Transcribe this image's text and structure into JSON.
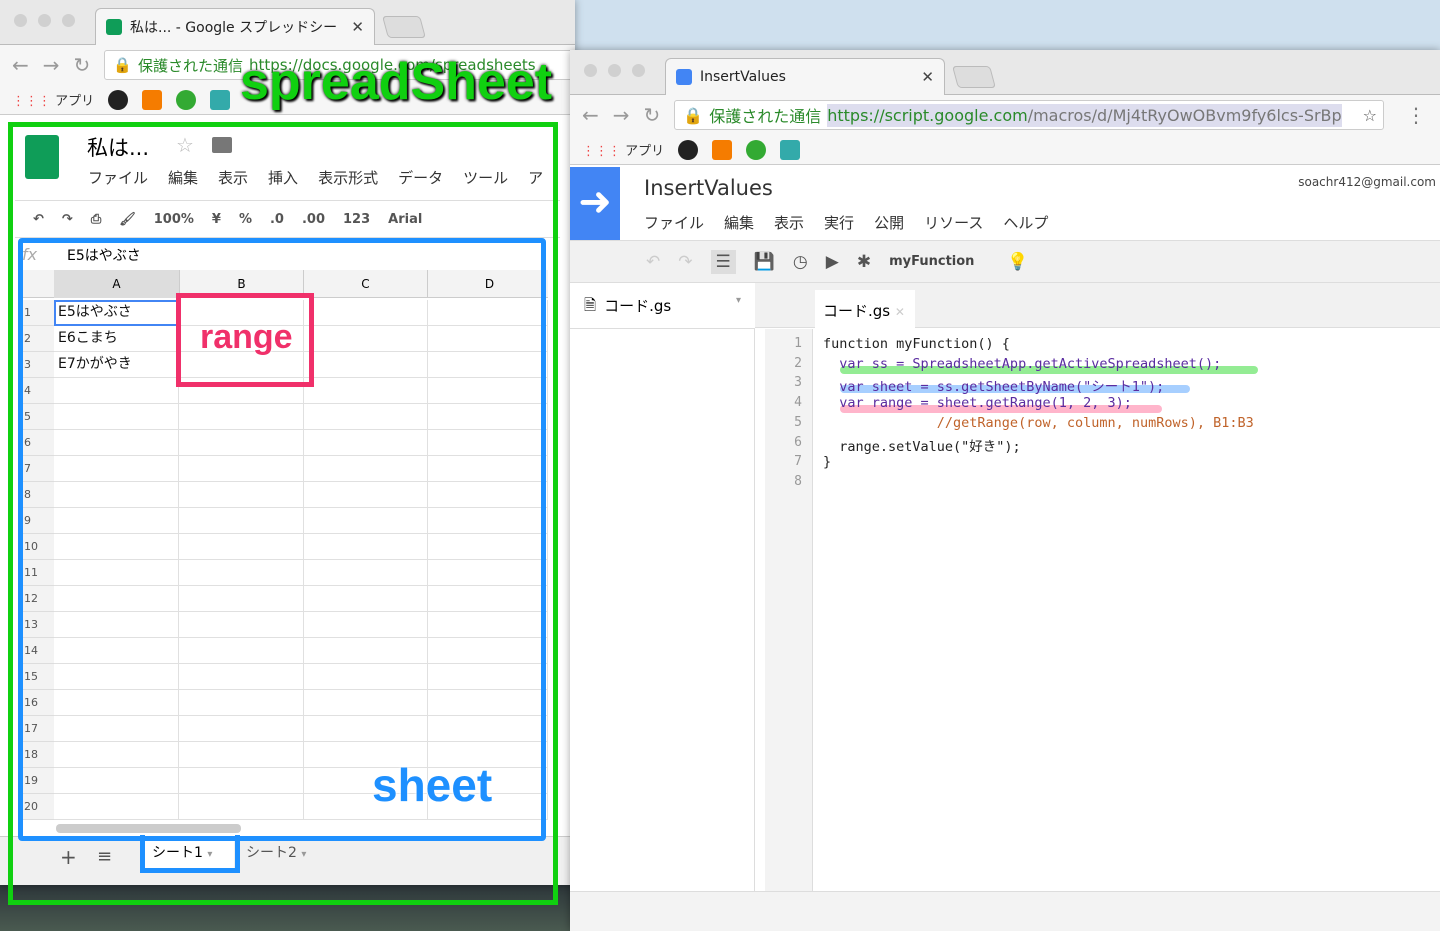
{
  "sheets_window": {
    "tab_title": "私は... - Google スプレッドシー",
    "secure_label": "保護された通信",
    "url": "https://docs.google.com/spreadsheets",
    "bookmarks_apps": "アプリ",
    "doc_title": "私は...",
    "menu": [
      "ファイル",
      "編集",
      "表示",
      "挿入",
      "表示形式",
      "データ",
      "ツール",
      "ア"
    ],
    "toolbar": {
      "zoom": "100%",
      "currency": "¥",
      "percent": "%",
      "dec_less": ".0",
      "dec_more": ".00",
      "number_format": "123",
      "font": "Arial"
    },
    "formula_fx": "fx",
    "formula_value": "E5はやぶさ",
    "columns": [
      "A",
      "B",
      "C",
      "D"
    ],
    "rows": [
      "1",
      "2",
      "3",
      "4",
      "5",
      "6",
      "7",
      "8",
      "9",
      "10",
      "11",
      "12",
      "13",
      "14",
      "15",
      "16",
      "17",
      "18",
      "19",
      "20"
    ],
    "cells_a": [
      "E5はやぶさ",
      "E6こまち",
      "E7かがやき"
    ],
    "sheet_tabs": [
      "シート1",
      "シート2"
    ]
  },
  "annotations": {
    "spreadsheet": "spreadSheet",
    "range": "range",
    "sheet": "sheet"
  },
  "script_window": {
    "tab_title": "InsertValues",
    "secure_label": "保護された通信",
    "url_host": "https://script.google.com",
    "url_path": "/macros/d/Mj4tRyOwOBvm9fy6lcs-SrBp",
    "bookmarks_apps": "アプリ",
    "project_title": "InsertValues",
    "account": "soachr412@gmail.com",
    "menu": [
      "ファイル",
      "編集",
      "表示",
      "実行",
      "公開",
      "リソース",
      "ヘルプ"
    ],
    "function_select": "myFunction",
    "file_name": "コード.gs",
    "editor_tab": "コード.gs",
    "line_numbers": [
      "1",
      "2",
      "3",
      "4",
      "5",
      "6",
      "7",
      "8"
    ],
    "code_lines": [
      "function myFunction() {",
      "  var ss = SpreadsheetApp.getActiveSpreadsheet();",
      "  var sheet = ss.getSheetByName(\"シート1\");",
      "  var range = sheet.getRange(1, 2, 3);",
      "              //getRange(row, column, numRows), B1:B3",
      "  range.setValue(\"好き\");",
      "}",
      ""
    ]
  },
  "colors": {
    "green": "#10d010",
    "blue": "#1e90ff",
    "pink": "#f0306a",
    "apps_blue": "#4285f4",
    "sheets_green": "#0f9d58"
  }
}
